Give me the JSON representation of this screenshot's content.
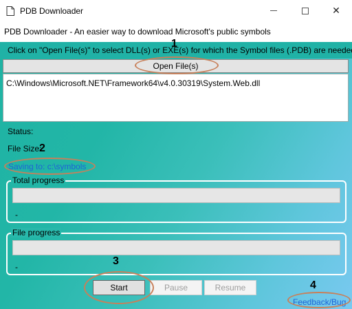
{
  "window": {
    "title": "PDB Downloader",
    "icon": "document-icon",
    "controls": {
      "minimize": "minimize-icon",
      "maximize": "maximize-icon",
      "close": "✕"
    }
  },
  "subtitle": "PDB Downloader - An easier way to download Microsoft's public symbols",
  "instruction": "Click on \"Open File(s)\" to select DLL(s) or EXE(s) for which the Symbol files (.PDB) are needed",
  "open_button": "Open File(s)",
  "files": [
    "C:\\Windows\\Microsoft.NET\\Framework64\\v4.0.30319\\System.Web.dll"
  ],
  "status_label": "Status:",
  "file_size_label": "File Size:",
  "saving_link": "Saving to: c:\\symbols",
  "total_progress": {
    "label": "Total progress",
    "text": "-",
    "percent": 0
  },
  "file_progress": {
    "label": "File progress",
    "text": "-",
    "percent": 0
  },
  "buttons": {
    "start": "Start",
    "pause": "Pause",
    "resume": "Resume"
  },
  "feedback_link": "Feedback/Bug",
  "annotations": [
    "1",
    "2",
    "3",
    "4"
  ],
  "colors": {
    "background_start": "#1fb3a3",
    "background_end": "#79c9f0",
    "link": "#1f63d6",
    "annotation": "#c8805a"
  }
}
